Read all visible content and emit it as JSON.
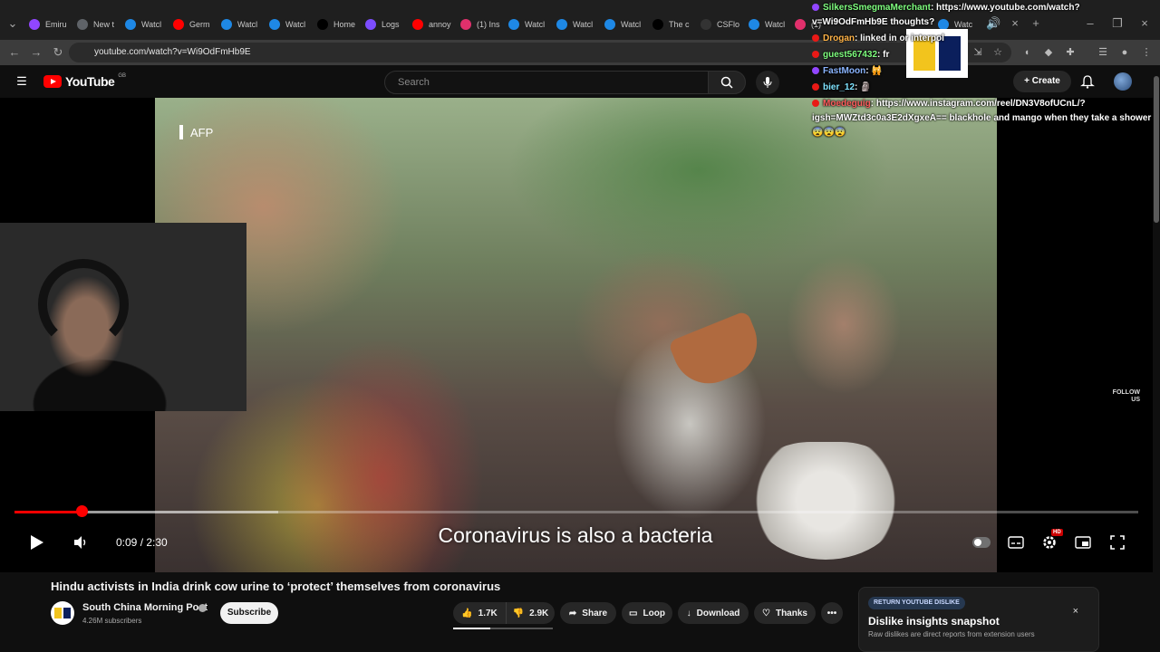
{
  "browser": {
    "tabs": [
      {
        "label": "Emiru",
        "color": "#9146ff"
      },
      {
        "label": "New t",
        "color": "#5f6368"
      },
      {
        "label": "Watcl",
        "color": "#1e88e5"
      },
      {
        "label": "Germ",
        "color": "#ff0000"
      },
      {
        "label": "Watcl",
        "color": "#1e88e5"
      },
      {
        "label": "Watcl",
        "color": "#1e88e5"
      },
      {
        "label": "Home",
        "color": "#000000"
      },
      {
        "label": "Logs",
        "color": "#7c4dff"
      },
      {
        "label": "annoy",
        "color": "#ff0000"
      },
      {
        "label": "(1) Ins",
        "color": "#e1306c"
      },
      {
        "label": "Watcl",
        "color": "#1e88e5"
      },
      {
        "label": "Watcl",
        "color": "#1e88e5"
      },
      {
        "label": "Watcl",
        "color": "#1e88e5"
      },
      {
        "label": "The c",
        "color": "#000000"
      },
      {
        "label": "CSFlo",
        "color": "#333333"
      },
      {
        "label": "Watcl",
        "color": "#1e88e5"
      },
      {
        "label": "(1)",
        "color": "#e1306c"
      }
    ],
    "hidden_tabs": [
      {
        "label": "Watc",
        "color": "#1e88e5"
      }
    ],
    "url": "youtube.com/watch?v=Wi9OdFmHb9E"
  },
  "youtube": {
    "logo_text": "YouTube",
    "country_code": "GB",
    "search_placeholder": "Search",
    "create_label": "Create"
  },
  "video": {
    "watermark": "AFP",
    "follow_text": "FOLLOW US",
    "caption": "Coronavirus is also a bacteria",
    "time": "0:09 / 2:30",
    "progress_fraction": 0.06,
    "buffered_fraction": 0.235,
    "hd_badge": "HD"
  },
  "chat": [
    {
      "user": "SilkersSmegmaMerchant",
      "user_color": "#7fff7f",
      "dot_color": "#9146ff",
      "text": ": https://www.youtube.com/watch?"
    },
    {
      "user": "",
      "user_color": "#ffffff",
      "dot_color": "",
      "text": "v=Wi9OdFmHb9E thoughts?"
    },
    {
      "user": "Drogan",
      "user_color": "#ffb347",
      "dot_color": "#e91916",
      "text": ": linked in or interpol"
    },
    {
      "user": "guest567432",
      "user_color": "#7fff7f",
      "dot_color": "#e91916",
      "text": ": fr"
    },
    {
      "user": "FastMoon",
      "user_color": "#8ab4ff",
      "dot_color": "#9146ff",
      "text": ": 🙀"
    },
    {
      "user": "bier_12",
      "user_color": "#7fe3ff",
      "dot_color": "#e91916",
      "text": ": 🗿"
    },
    {
      "user": "Moedeguig",
      "user_color": "#ff5c5c",
      "dot_color": "#e91916",
      "text": ": https://www.instagram.com/reel/DN3V8ofUCnL/?"
    },
    {
      "user": "",
      "user_color": "#ffffff",
      "dot_color": "",
      "text": "igsh=MWZtd3c0a3E2dXgxeA== blackhole and mango when they take a shower"
    },
    {
      "user": "",
      "user_color": "#ffffff",
      "dot_color": "",
      "text": "😨😨😨"
    }
  ],
  "meta": {
    "title": "Hindu activists in India drink cow urine to ‘protect’ themselves from coronavirus",
    "channel": "South China Morning Post",
    "subscribers": "4.26M subscribers",
    "subscribe_label": "Subscribe",
    "likes": "1.7K",
    "dislikes": "2.9K",
    "like_ratio": 0.37,
    "share_label": "Share",
    "loop_label": "Loop",
    "download_label": "Download",
    "thanks_label": "Thanks"
  },
  "ryd": {
    "badge": "RETURN YOUTUBE DISLIKE",
    "title": "Dislike insights snapshot",
    "description": "Raw dislikes are direct reports from extension users",
    "close": "×"
  }
}
